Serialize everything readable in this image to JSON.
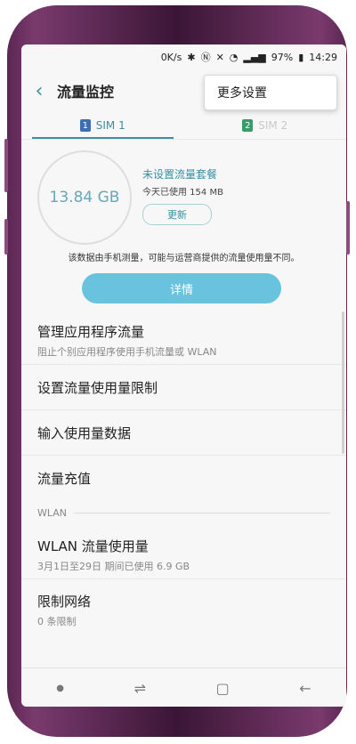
{
  "status": {
    "net_speed": "0K/s",
    "battery": "97%",
    "time": "14:29"
  },
  "appbar": {
    "title": "流量监控",
    "menu_popup": "更多设置"
  },
  "tabs": [
    {
      "num": "1",
      "label": "SIM 1",
      "color": "#3a6fb0"
    },
    {
      "num": "2",
      "label": "SIM 2",
      "color": "#3a9a6a"
    }
  ],
  "summary": {
    "usage": "13.84 GB",
    "plan_status": "未设置流量套餐",
    "today_used": "今天已使用 154 MB",
    "refresh_label": "更新",
    "note": "该数据由手机测量，可能与运营商提供的流量使用量不同。",
    "details_label": "详情"
  },
  "list": {
    "manage": {
      "title": "管理应用程序流量",
      "sub": "阻止个别应用程序使用手机流量或 WLAN"
    },
    "limit": {
      "title": "设置流量使用量限制"
    },
    "input": {
      "title": "输入使用量数据"
    },
    "recharge": {
      "title": "流量充值"
    },
    "wlan_section": "WLAN",
    "wlan_usage": {
      "title": "WLAN 流量使用量",
      "sub": "3月1日至29日 期间已使用 6.9 GB"
    },
    "restrict": {
      "title": "限制网络",
      "sub": "0 条限制"
    }
  },
  "colors": {
    "accent": "#3a8fa3",
    "button": "#6ac3de",
    "phone_frame": "#6a2f5f"
  }
}
